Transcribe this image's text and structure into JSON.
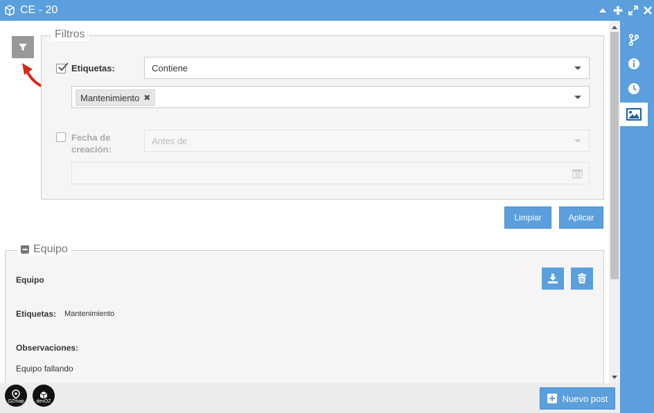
{
  "window": {
    "title": "CE - 20"
  },
  "filters": {
    "legend": "Filtros",
    "tags_label": "Etiquetas:",
    "tags_operator": "Contiene",
    "tags_chip": "Mantenimiento",
    "date_label_line1": "Fecha de",
    "date_label_line2": "creación:",
    "date_operator": "Antes de",
    "clear_label": "Limpiar",
    "apply_label": "Aplicar"
  },
  "post": {
    "legend": "Equipo",
    "title": "Equipo",
    "tags_label": "Etiquetas:",
    "tags_value": "Mantenimiento",
    "notes_label": "Observaciones:",
    "notes_value": "Equipo fallando"
  },
  "footer": {
    "new_post_label": "Nuevo post",
    "logo1_text": "OZmap",
    "logo2_text": "devOZ"
  },
  "colors": {
    "accent": "#5b9fdc",
    "annotation": "#d9261c"
  }
}
